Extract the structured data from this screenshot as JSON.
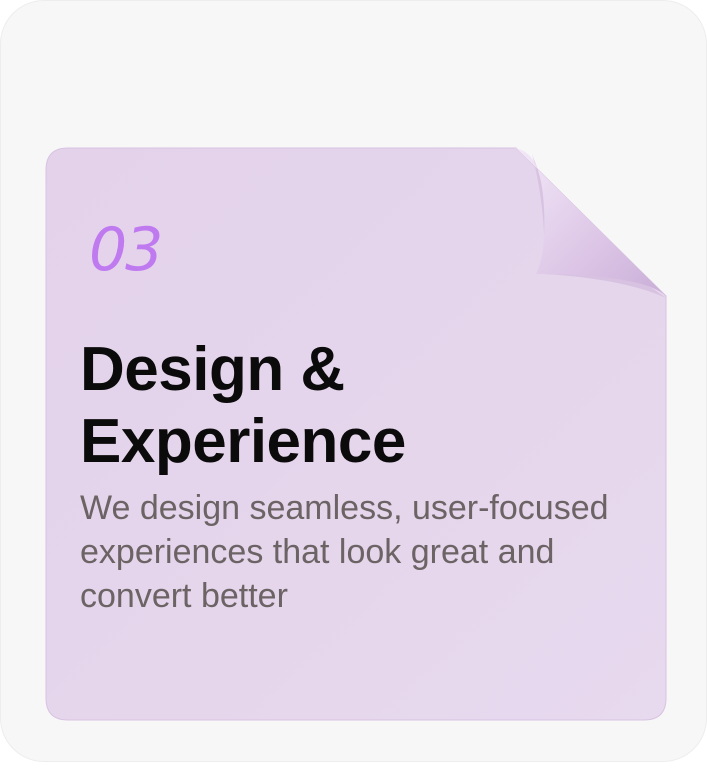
{
  "card": {
    "number": "03",
    "title": "Design & Experience",
    "description": "We design seamless, user-focused experiences that look great and convert better"
  },
  "colors": {
    "outer_background": "#f7f7f7",
    "note_fill": "#e6d6ec",
    "number_accent": "#c07af0",
    "title_text": "#0b0b0b",
    "body_text": "#6b6364"
  }
}
